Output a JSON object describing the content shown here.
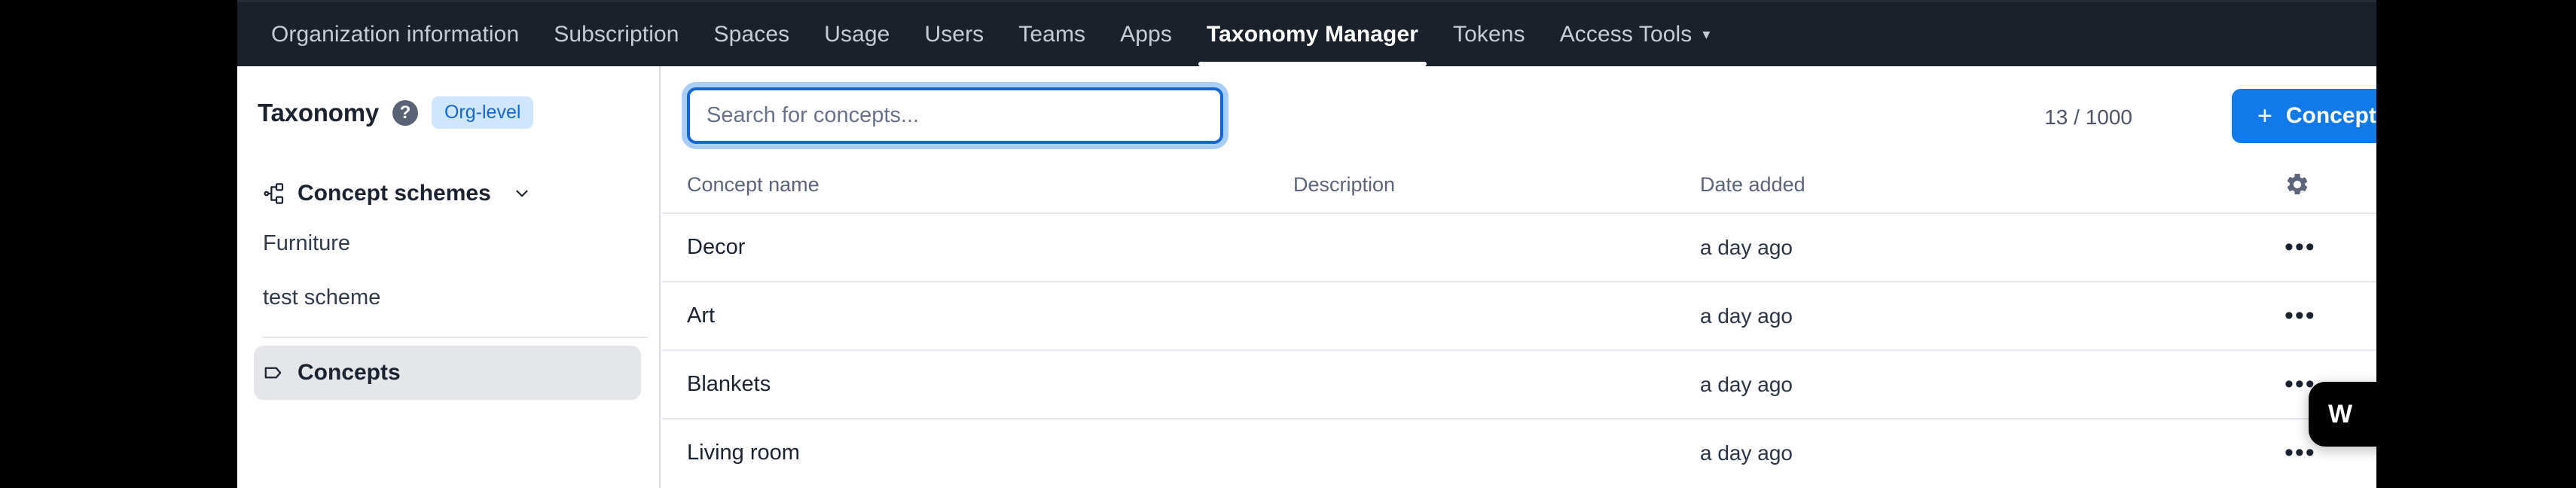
{
  "topnav": {
    "items": [
      {
        "label": "Organization information",
        "active": false
      },
      {
        "label": "Subscription",
        "active": false
      },
      {
        "label": "Spaces",
        "active": false
      },
      {
        "label": "Usage",
        "active": false
      },
      {
        "label": "Users",
        "active": false
      },
      {
        "label": "Teams",
        "active": false
      },
      {
        "label": "Apps",
        "active": false
      },
      {
        "label": "Taxonomy Manager",
        "active": true
      },
      {
        "label": "Tokens",
        "active": false
      },
      {
        "label": "Access Tools",
        "active": false,
        "caret": "▾"
      }
    ]
  },
  "sidebar": {
    "title": "Taxonomy",
    "help_icon": "help-icon",
    "badge": "Org-level",
    "schemes": {
      "icon": "hierarchy-icon",
      "label": "Concept schemes",
      "chevron": "chevron-down-icon"
    },
    "scheme_items": [
      {
        "label": "Furniture"
      },
      {
        "label": "test scheme"
      }
    ],
    "concepts": {
      "icon": "tag-icon",
      "label": "Concepts",
      "selected": true
    }
  },
  "toolbar": {
    "search_placeholder": "Search for concepts...",
    "search_value": "",
    "counter": "13 / 1000",
    "add_button_label": "Concept",
    "add_button_plus": "+"
  },
  "table": {
    "columns": {
      "name": "Concept name",
      "description": "Description",
      "date": "Date added"
    },
    "settings_icon": "gear-icon",
    "row_menu_glyph": "•••",
    "rows": [
      {
        "name": "Decor",
        "description": "",
        "date": "a day ago"
      },
      {
        "name": "Art",
        "description": "",
        "date": "a day ago"
      },
      {
        "name": "Blankets",
        "description": "",
        "date": "a day ago"
      },
      {
        "name": "Living room",
        "description": "",
        "date": "a day ago"
      }
    ]
  },
  "chat_widget": {
    "label": "W"
  },
  "colors": {
    "nav_bg": "#1b212b",
    "accent_blue": "#1279e8",
    "badge_bg": "#cfe6fd",
    "badge_text": "#1366d6",
    "focus_ring": "#a8cdf7",
    "selected_item_bg": "#e4e6e9",
    "row_border": "#e3e8ee",
    "text_primary": "#1c2330",
    "text_muted": "#5b6478"
  }
}
